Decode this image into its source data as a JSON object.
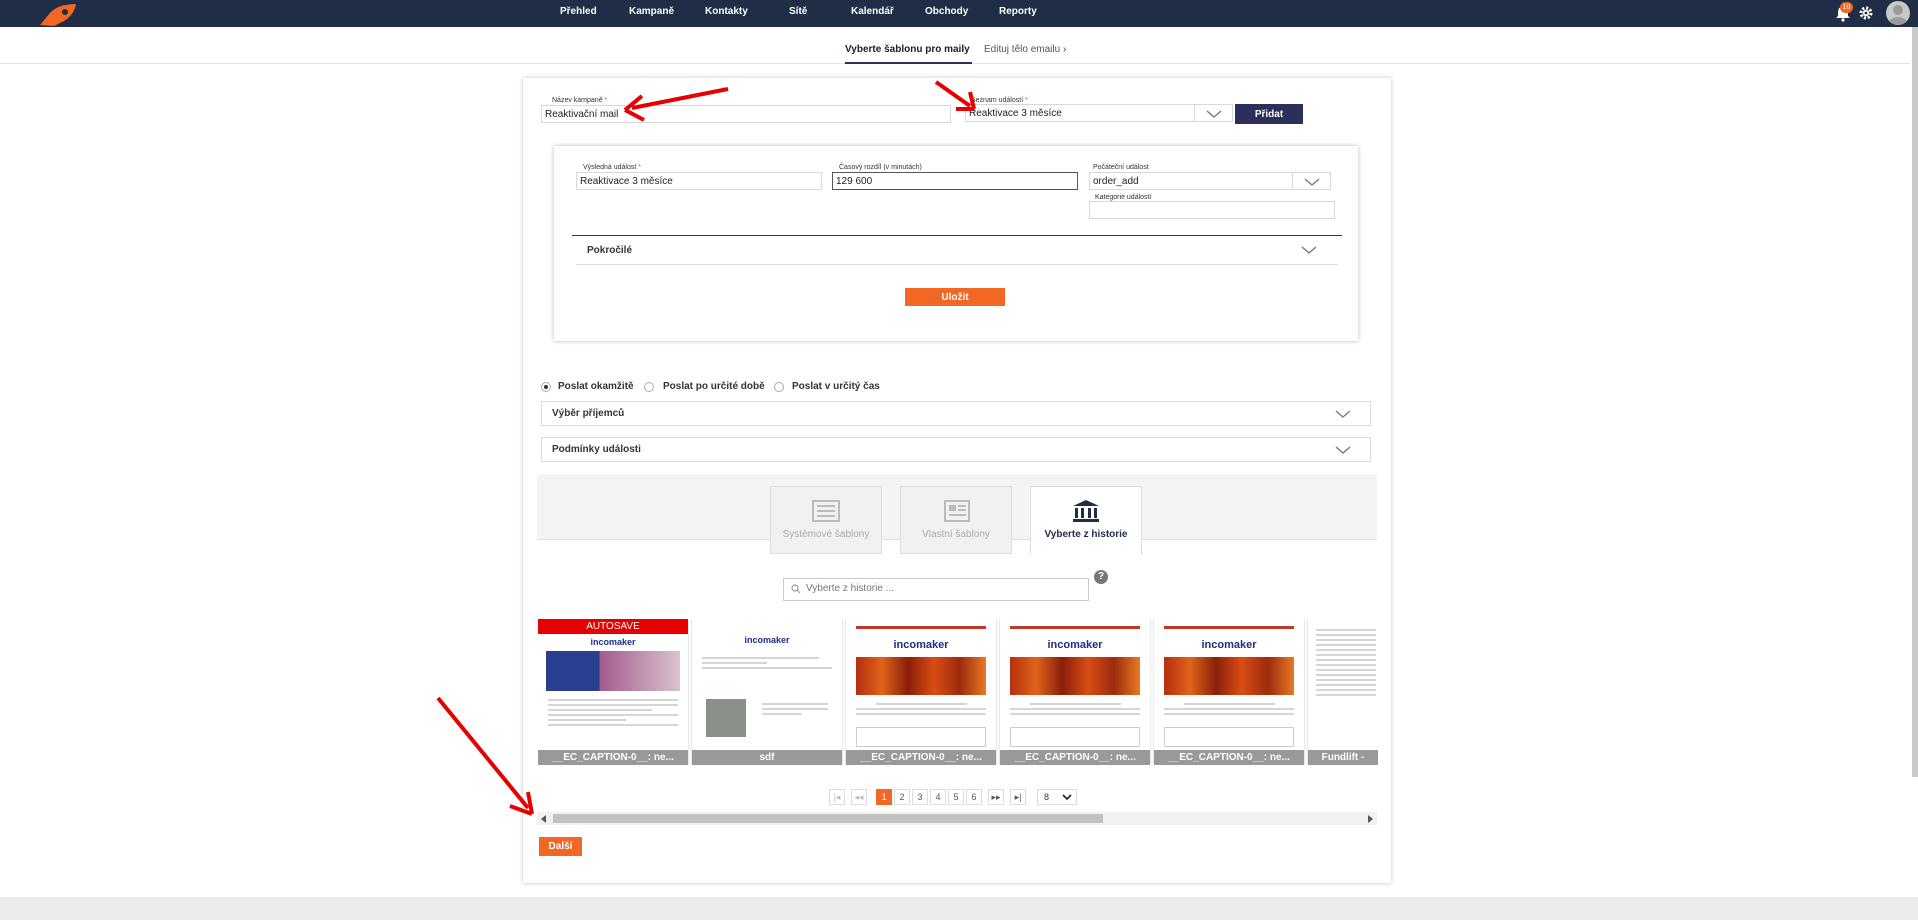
{
  "nav": {
    "items": [
      "Přehled",
      "Kampaně",
      "Kontakty",
      "Sítě",
      "Kalendář",
      "Obchody",
      "Reporty"
    ],
    "notification_count": "10",
    "icons": {
      "logo": "rocket-logo",
      "bell": "bell-icon",
      "settings": "gear-icon",
      "user": "avatar"
    }
  },
  "steps": {
    "step1": "Vyberte šablonu pro maily",
    "step2": "Edituj tělo emailu"
  },
  "form": {
    "campaign_name_label": "Název kampaně",
    "campaign_name_value": "Reaktivační mail",
    "event_list_label": "Seznam událostí",
    "event_list_value": "Reaktivace 3 měsíce",
    "add_button": "Přidat",
    "result_event_label": "Výsledná událost",
    "result_event_value": "Reaktivace 3 měsíce",
    "time_diff_label": "Časový rozdíl (v minutách)",
    "time_diff_value": "129 600",
    "start_event_label": "Počáteční událost",
    "start_event_value": "order_add",
    "event_category_label": "Kategorie události",
    "event_category_value": "",
    "advanced_label": "Pokročilé",
    "save_button": "Uložit",
    "required_mark": "*"
  },
  "send_options": {
    "now": "Poslat okamžitě",
    "after": "Poslat po určité době",
    "at": "Poslat v určitý čas",
    "selected": "now"
  },
  "accordions": {
    "recipients": "Výběr příjemců",
    "conditions": "Podmínky události"
  },
  "template_tabs": {
    "system": "Systémové šablony",
    "own": "Vlastní šablony",
    "history": "Vyberte z historie"
  },
  "search": {
    "placeholder": "Vyberte z historie ..."
  },
  "help_icon": "?",
  "thumbnails": [
    {
      "caption": "__EC_CAPTION-0__: ne...",
      "badge": "AUTOSAVE",
      "brand": "incomaker"
    },
    {
      "caption": "sdf",
      "brand": "incomaker"
    },
    {
      "caption": "__EC_CAPTION-0__: ne...",
      "brand": "incomaker"
    },
    {
      "caption": "__EC_CAPTION-0__: ne...",
      "brand": "incomaker"
    },
    {
      "caption": "__EC_CAPTION-0__: ne...",
      "brand": "incomaker"
    },
    {
      "caption": "Fundlift -",
      "brand": ""
    }
  ],
  "pagination": {
    "first": "|◂",
    "prev": "◂◂",
    "pages": [
      "1",
      "2",
      "3",
      "4",
      "5",
      "6"
    ],
    "current": "1",
    "next": "▸▸",
    "last": "▸|",
    "page_size": "8"
  },
  "next_button": "Další",
  "colors": {
    "navbar": "#1f2d46",
    "accent": "#f26722",
    "navy": "#2b2f5b",
    "annotation": "#e60000"
  }
}
